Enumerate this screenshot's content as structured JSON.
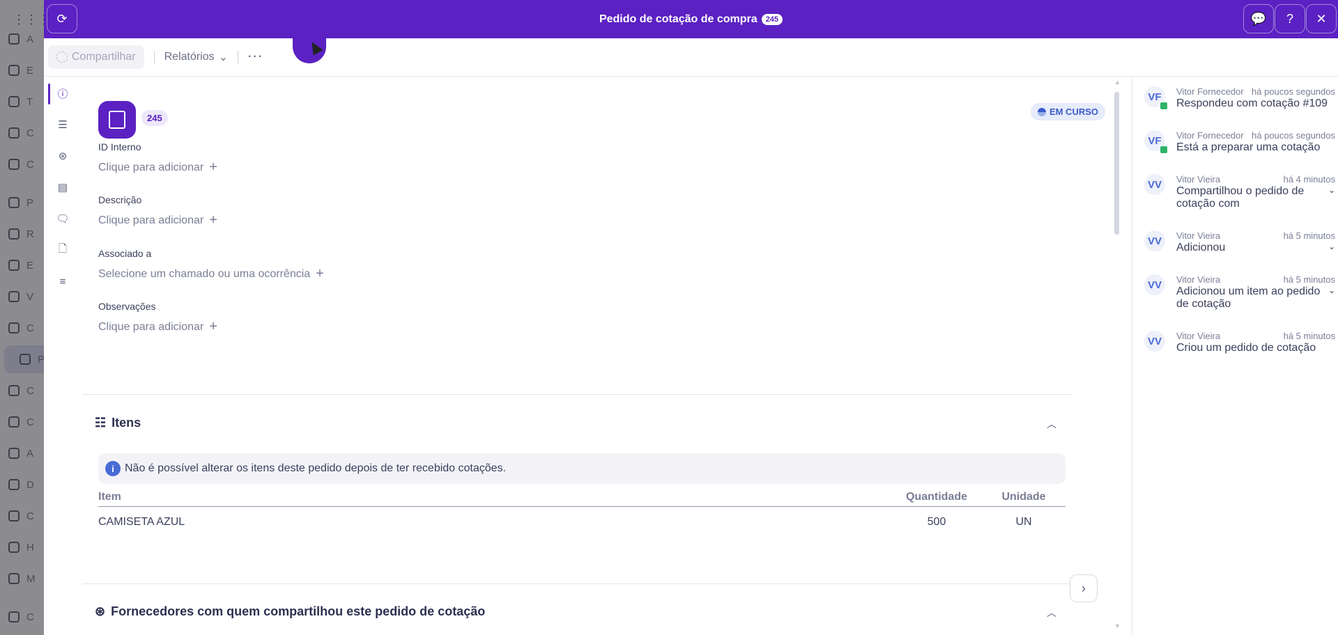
{
  "background": {
    "sidebar_labels": [
      "A",
      "E",
      "T",
      "C",
      "C",
      "P",
      "R",
      "E",
      "V",
      "C",
      "P",
      "C",
      "C",
      "A",
      "D",
      "C",
      "H",
      "M",
      "C"
    ]
  },
  "modal": {
    "title": "Pedido de cotação de compra",
    "title_count": "245",
    "toolbar": {
      "share_label": "Compartilhar",
      "reports_label": "Relatórios",
      "more_label": "···"
    }
  },
  "record": {
    "id_badge": "245",
    "status": "EM CURSO",
    "fields": [
      {
        "label": "ID Interno",
        "value": "Clique para adicionar"
      },
      {
        "label": "Descrição",
        "value": "Clique para adicionar"
      },
      {
        "label": "Associado a",
        "value": "Selecione um chamado ou uma ocorrência"
      },
      {
        "label": "Observações",
        "value": "Clique para adicionar"
      }
    ]
  },
  "items_section": {
    "title": "Itens",
    "info": "Não é possível alterar os itens deste pedido depois de ter recebido cotações.",
    "columns": {
      "item": "Item",
      "qty": "Quantidade",
      "unit": "Unidade"
    },
    "rows": [
      {
        "item": "CAMISETA AZUL",
        "qty": "500",
        "unit": "UN"
      }
    ]
  },
  "suppliers_section": {
    "title": "Fornecedores com quem compartilhou este pedido de cotação"
  },
  "activity": [
    {
      "initials": "VF",
      "who": "Vitor Fornecedor",
      "when": "há poucos segundos",
      "what": "Respondeu com cotação #109",
      "expandable": false
    },
    {
      "initials": "VF",
      "who": "Vitor Fornecedor",
      "when": "há poucos segundos",
      "what": "Está a preparar uma cotação",
      "expandable": false
    },
    {
      "initials": "VV",
      "who": "Vitor Vieira",
      "when": "há 4 minutos",
      "what": "Compartilhou o pedido de cotação com",
      "expandable": true
    },
    {
      "initials": "VV",
      "who": "Vitor Vieira",
      "when": "há 5 minutos",
      "what": "Adicionou",
      "expandable": true
    },
    {
      "initials": "VV",
      "who": "Vitor Vieira",
      "when": "há 5 minutos",
      "what": "Adicionou um item ao pedido de cotação",
      "expandable": true
    },
    {
      "initials": "VV",
      "who": "Vitor Vieira",
      "when": "há 5 minutos",
      "what": "Criou um pedido de cotação",
      "expandable": false
    }
  ],
  "colors": {
    "brand": "#5b21c2",
    "status_blue": "#3b5bc9",
    "supplier_badge": "#2fb36a"
  }
}
